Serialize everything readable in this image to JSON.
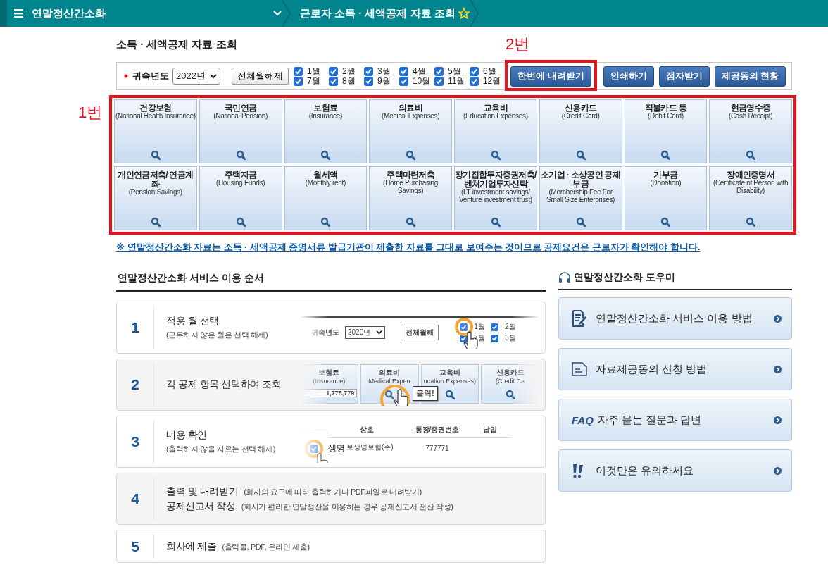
{
  "topbar": {
    "menu_title": "연말정산간소화",
    "breadcrumb": "근로자 소득 · 세액공제 자료 조회",
    "favorite": false
  },
  "page_title": "소득 · 세액공제 자료 조회",
  "filter": {
    "year_label": "귀속년도",
    "year": "2022년",
    "clear_button": "전체월해제",
    "months": [
      {
        "label": "1월",
        "checked": true
      },
      {
        "label": "2월",
        "checked": true
      },
      {
        "label": "3월",
        "checked": true
      },
      {
        "label": "4월",
        "checked": true
      },
      {
        "label": "5월",
        "checked": true
      },
      {
        "label": "6월",
        "checked": true
      },
      {
        "label": "7월",
        "checked": true
      },
      {
        "label": "8월",
        "checked": true
      },
      {
        "label": "9월",
        "checked": true
      },
      {
        "label": "10월",
        "checked": true
      },
      {
        "label": "11월",
        "checked": true
      },
      {
        "label": "12월",
        "checked": true
      }
    ],
    "buttons": [
      "한번에 내려받기",
      "인쇄하기",
      "점자받기",
      "제공동의 현황"
    ]
  },
  "annotations": {
    "download": "2번",
    "categories": "1번"
  },
  "categories": [
    {
      "name": "건강보험",
      "english": "(National Health Insurance)"
    },
    {
      "name": "국민연금",
      "english": "(National Pension)"
    },
    {
      "name": "보험료",
      "english": "(Insurance)"
    },
    {
      "name": "의료비",
      "english": "(Medical Expenses)"
    },
    {
      "name": "교육비",
      "english": "(Education Expenses)"
    },
    {
      "name": "신용카드",
      "english": "(Credit Card)"
    },
    {
      "name": "직불카드 등",
      "english": "(Debit Card)"
    },
    {
      "name": "현금영수증",
      "english": "(Cash Receipt)"
    },
    {
      "name": "개인연금저축/ 연금계좌",
      "english": "(Pension Savings)"
    },
    {
      "name": "주택자금",
      "english": "(Housing Funds)"
    },
    {
      "name": "월세액",
      "english": "(Monthly rent)"
    },
    {
      "name": "주택마련저축",
      "english": "(Home Purchasing Savings)"
    },
    {
      "name": "장기집합투자증권저축/ 벤처기업투자신탁",
      "english": "(LT investment savings/ Venture investment trust)"
    },
    {
      "name": "소기업 · 소상공인 공제부금",
      "english": "(Membership Fee For Small Size Enterprises)"
    },
    {
      "name": "기부금",
      "english": "(Donation)"
    },
    {
      "name": "장애인증명서",
      "english": "(Certificate of Person with Disability)"
    }
  ],
  "notice": "※ 연말정산간소화 자료는 소득 · 세액공제 증명서류 발급기관이 제출한 자료를 그대로 보여주는 것이므로 공제요건은 근로자가 확인해야 합니다.",
  "guide": {
    "title": "연말정산간소화 서비스 이용 순서",
    "steps": [
      {
        "number": "1",
        "kind": "stacked",
        "lines": [
          {
            "title": "적용 월 선택",
            "note": "(근무하지 않은 월은 선택 해제)"
          }
        ],
        "illustration": {
          "kind": "months",
          "year_label": "귀속년도",
          "year": "2020년",
          "button": "전체월해",
          "months": [
            {
              "label": "1월",
              "checked": true
            },
            {
              "label": "2월",
              "checked": true
            },
            {
              "label": "7월",
              "checked": true
            },
            {
              "label": "8월",
              "checked": true
            }
          ]
        }
      },
      {
        "number": "2",
        "kind": "stacked",
        "lines": [
          {
            "title": "각 공제 항목 선택하여 조회"
          }
        ],
        "illustration": {
          "kind": "tiles",
          "callout": "클릭!",
          "tiles": [
            {
              "name": "보험료",
              "english": "(Insurance)",
              "amount": "1,775,779"
            },
            {
              "name": "의료비",
              "english": "Medical Expen"
            },
            {
              "name": "교육비",
              "english": "ucation Expenses)"
            },
            {
              "name": "신용카드",
              "english": "(Credit Ca"
            }
          ]
        }
      },
      {
        "number": "3",
        "kind": "stacked",
        "lines": [
          {
            "title": "내용 확인",
            "note": "(출력하지 않을 자료는 선택 해제)"
          }
        ],
        "illustration": {
          "kind": "table",
          "columns": [
            "상호",
            "통장/증권번호",
            "납입"
          ],
          "rows": [
            {
              "checked": true,
              "label": "생명",
              "company": "보생명보험(주)",
              "account": "777771"
            }
          ]
        }
      },
      {
        "number": "4",
        "kind": "inline",
        "lines": [
          {
            "title": "출력 및 내려받기",
            "note": "(회사의 요구에 따라 출력하거나 PDF파일로 내려받기)"
          },
          {
            "title": "공제신고서 작성",
            "note": "(회사가 편리한 연말정산을 이용하는 경우 공제신고서 전산 작성)"
          }
        ]
      },
      {
        "number": "5",
        "kind": "inline",
        "lines": [
          {
            "title": "회사에 제출",
            "note": "(출력물, PDF, 온라인 제출)"
          }
        ]
      }
    ]
  },
  "helper": {
    "title": "연말정산간소화 도우미",
    "items": [
      {
        "kind": "guide",
        "label": "연말정산간소화 서비스 이용 방법"
      },
      {
        "kind": "form",
        "label": "자료제공동의 신청 방법"
      },
      {
        "kind": "faq",
        "badge": "FAQ",
        "label": "자주 묻는 질문과 답변"
      },
      {
        "kind": "warning",
        "label": "이것만은 유의하세요"
      }
    ]
  }
}
